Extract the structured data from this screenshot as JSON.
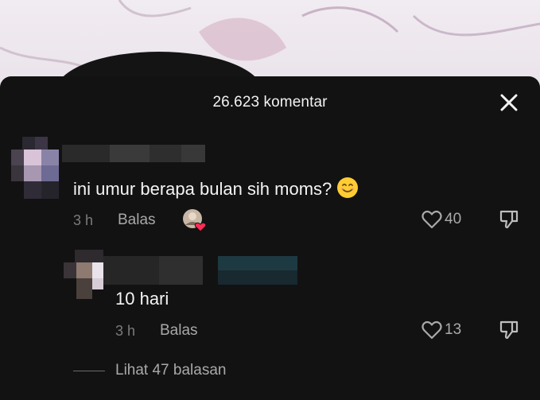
{
  "sheet": {
    "title": "26.623 komentar"
  },
  "comments": [
    {
      "text": "ini umur berapa bulan sih moms?",
      "emoji": "smiling-face-emoji",
      "time": "3 h",
      "reply_label": "Balas",
      "likes": "40",
      "liked_by_creator": true
    },
    {
      "text": "10 hari",
      "time": "3 h",
      "reply_label": "Balas",
      "likes": "13"
    }
  ],
  "view_replies": {
    "label": "Lihat 47 balasan"
  },
  "colors": {
    "sheet_bg": "#121212",
    "primary_text": "#f4f4f4",
    "secondary_text": "#a9a9a9",
    "heart_red": "#fe2c55",
    "emoji_yellow": "#ffcc33"
  }
}
